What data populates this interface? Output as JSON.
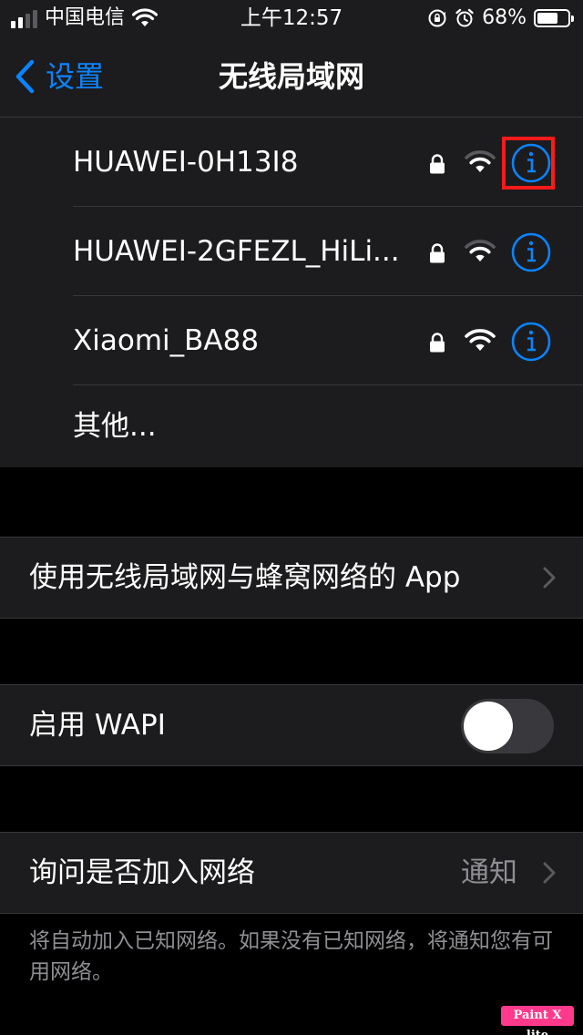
{
  "status_bar": {
    "carrier": "中国电信",
    "time": "上午12:57",
    "battery_percent_label": "68%",
    "battery_level": 0.68,
    "signal_bars_filled": 2,
    "signal_bars_total": 4,
    "icons": [
      "signal-icon",
      "wifi-icon",
      "orientation-lock-icon",
      "alarm-icon",
      "battery-icon"
    ]
  },
  "nav": {
    "back_label": "设置",
    "title": "无线局域网"
  },
  "networks": [
    {
      "name": "HUAWEI-0H13I8",
      "secured": true,
      "highlighted": true
    },
    {
      "name": "HUAWEI-2GFEZL_HiLi...",
      "secured": true,
      "highlighted": false
    },
    {
      "name": "Xiaomi_BA88",
      "secured": true,
      "highlighted": false
    }
  ],
  "other_label": "其他...",
  "apps_row": {
    "label": "使用无线局域网与蜂窝网络的 App"
  },
  "wapi_row": {
    "label": "启用 WAPI",
    "enabled": false
  },
  "ask_join_row": {
    "label": "询问是否加入网络",
    "value": "通知"
  },
  "footer_note": "将自动加入已知网络。如果没有已知网络，将通知您有可用网络。",
  "watermark": "Paint X lite",
  "colors": {
    "accent": "#0a84ff",
    "cell_background": "#1c1c1e",
    "page_background": "#000000",
    "separator": "#38383a",
    "secondary_text": "#8e8e93",
    "highlight": "#ff1a1a",
    "watermark": "#ff3a8c"
  }
}
